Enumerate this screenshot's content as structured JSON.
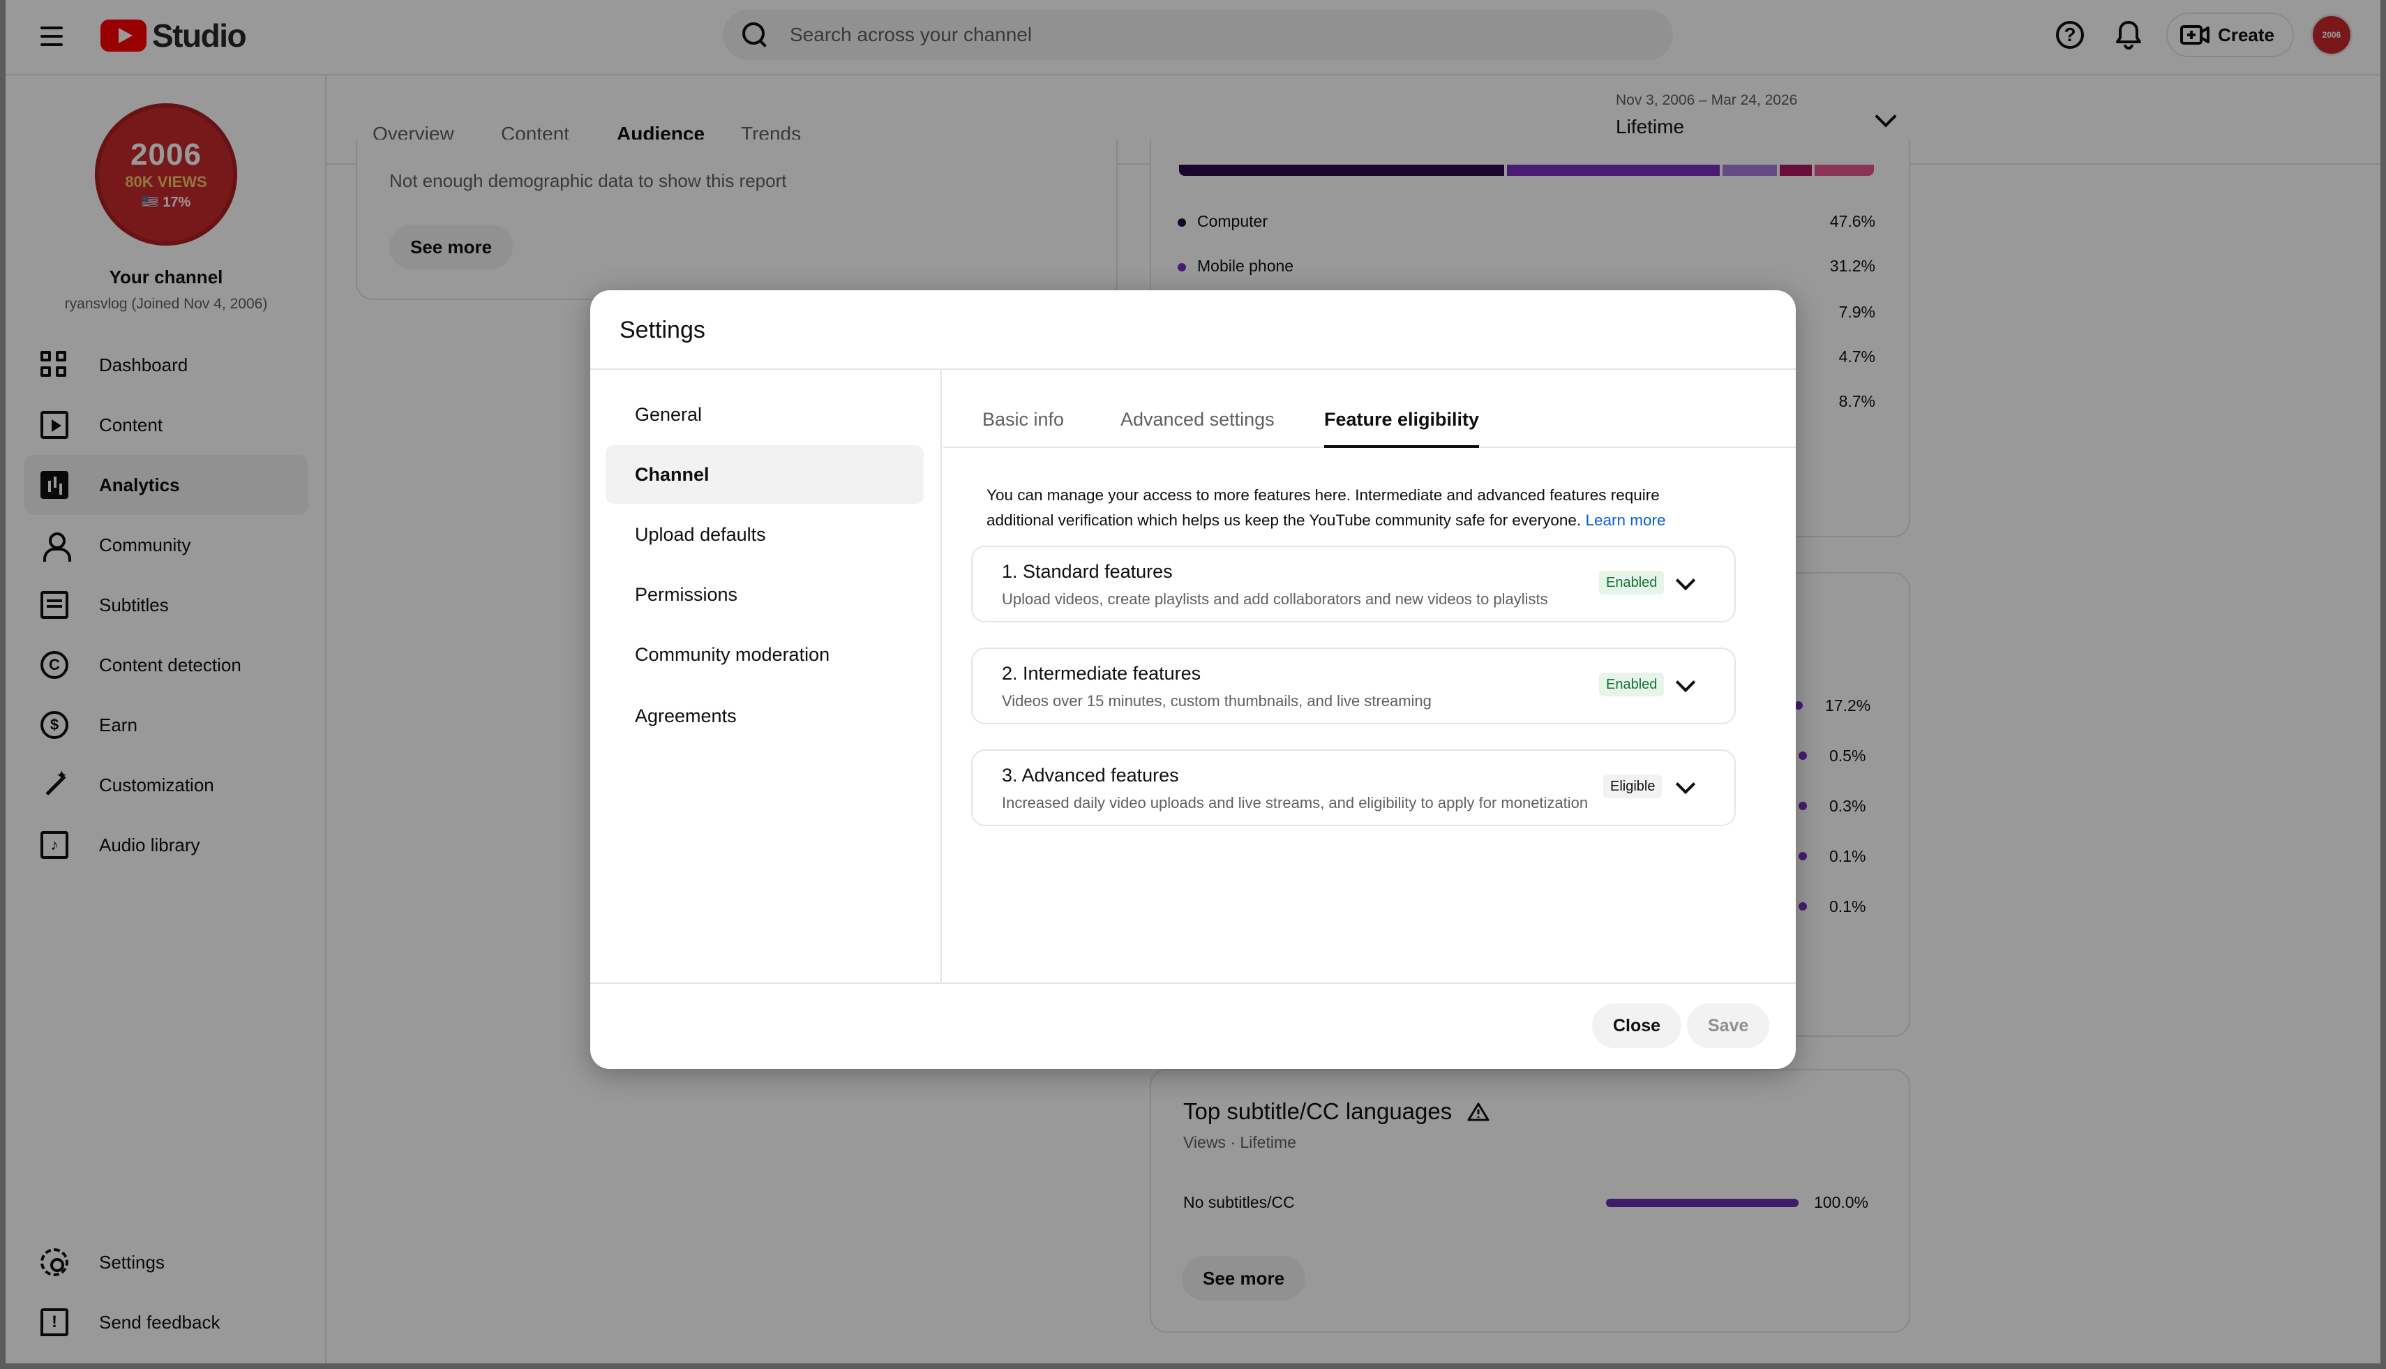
{
  "app": {
    "logo_text": "Studio"
  },
  "search": {
    "placeholder": "Search across your channel"
  },
  "topbar": {
    "create_label": "Create",
    "help_glyph": "?",
    "avatar_text": "2006"
  },
  "channel": {
    "avatar_line1": "2006",
    "avatar_line2": "80K VIEWS",
    "avatar_line3": "🇺🇸 17%",
    "name": "Your channel",
    "handle": "ryansvlog (Joined Nov 4, 2006)"
  },
  "sidebar": {
    "items": [
      {
        "label": "Dashboard",
        "icon": "dashboard-icon"
      },
      {
        "label": "Content",
        "icon": "content-icon"
      },
      {
        "label": "Analytics",
        "icon": "analytics-icon",
        "active": true
      },
      {
        "label": "Community",
        "icon": "community-icon"
      },
      {
        "label": "Subtitles",
        "icon": "subtitles-icon"
      },
      {
        "label": "Content detection",
        "icon": "copyright-icon"
      },
      {
        "label": "Earn",
        "icon": "dollar-icon"
      },
      {
        "label": "Customization",
        "icon": "magic-wand-icon"
      },
      {
        "label": "Audio library",
        "icon": "audio-library-icon"
      }
    ],
    "bottom": [
      {
        "label": "Settings",
        "icon": "gear-icon"
      },
      {
        "label": "Send feedback",
        "icon": "feedback-icon"
      }
    ]
  },
  "analytics": {
    "tabs": [
      "Overview",
      "Content",
      "Audience",
      "Trends"
    ],
    "active_tab": "Audience",
    "date_range": "Nov 3, 2006 – Mar 24, 2026",
    "period": "Lifetime",
    "demographics_empty": "Not enough demographic data to show this report",
    "see_more": "See more",
    "devices": [
      {
        "label": "Computer",
        "value": "47.6%"
      },
      {
        "label": "Mobile phone",
        "value": "31.2%"
      },
      {
        "label": "",
        "value": "7.9%"
      },
      {
        "label": "",
        "value": "4.7%"
      },
      {
        "label": "",
        "value": "8.7%"
      }
    ],
    "other_pcts": [
      "17.2%",
      "0.5%",
      "0.3%",
      "0.1%",
      "0.1%"
    ],
    "subtitles_card": {
      "title": "Top subtitle/CC languages",
      "subtitle": "Views · Lifetime",
      "row_label": "No subtitles/CC",
      "row_value": "100.0%",
      "see_more": "See more"
    },
    "colors": {
      "device_bar": [
        "#2b0a4d",
        "#7b2dbf",
        "#a77de0",
        "#b0185e",
        "#e5578e"
      ],
      "accent": "#6a2fb0"
    }
  },
  "dialog": {
    "title": "Settings",
    "menu": [
      "General",
      "Channel",
      "Upload defaults",
      "Permissions",
      "Community moderation",
      "Agreements"
    ],
    "active_menu": "Channel",
    "tabs": [
      "Basic info",
      "Advanced settings",
      "Feature eligibility"
    ],
    "active_tab": "Feature eligibility",
    "intro": "You can manage your access to more features here. Intermediate and advanced features require additional verification which helps us keep the YouTube community safe for everyone.",
    "learn_more": "Learn more",
    "features": [
      {
        "title": "1. Standard features",
        "desc": "Upload videos, create playlists and add collaborators and new videos to playlists",
        "status": "Enabled"
      },
      {
        "title": "2. Intermediate features",
        "desc": "Videos over 15 minutes, custom thumbnails, and live streaming",
        "status": "Enabled"
      },
      {
        "title": "3. Advanced features",
        "desc": "Increased daily video uploads and live streams, and eligibility to apply for monetization",
        "status": "Eligible"
      }
    ],
    "close_label": "Close",
    "save_label": "Save"
  }
}
